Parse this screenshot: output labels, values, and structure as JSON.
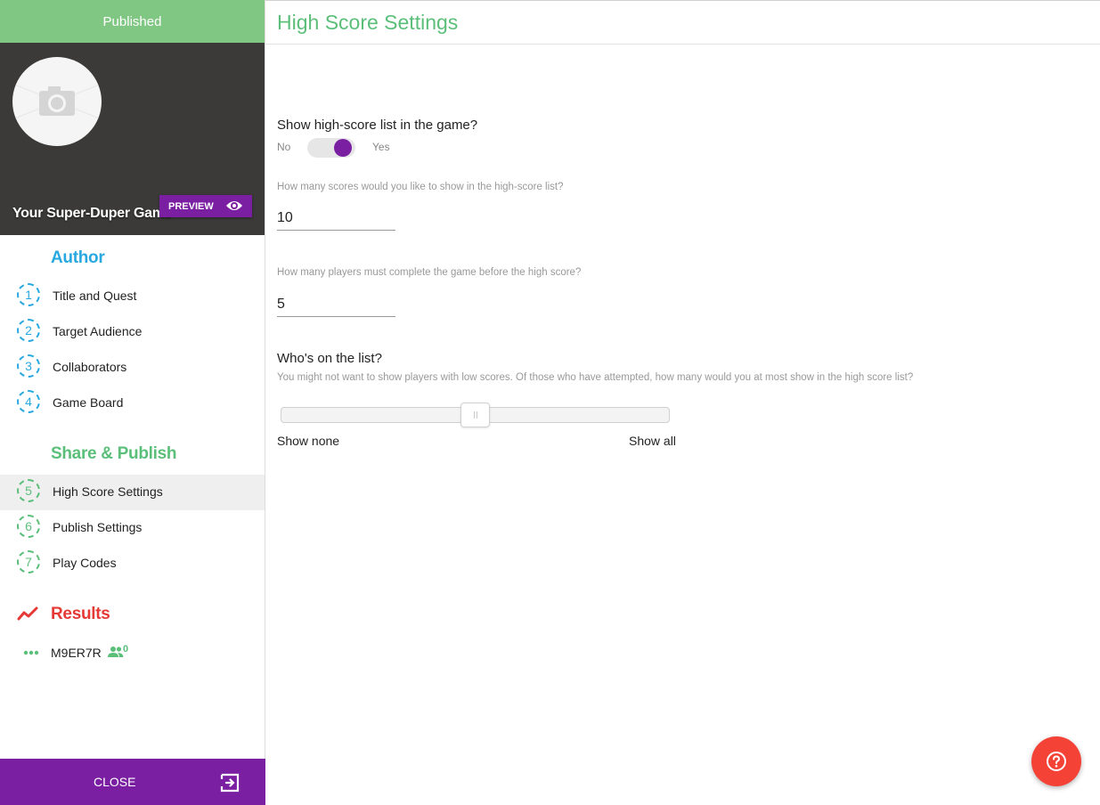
{
  "sidebar": {
    "status": "Published",
    "game_title": "Your Super-Duper Game",
    "preview_label": "PREVIEW",
    "author": {
      "title": "Author",
      "items": [
        {
          "number": "1",
          "label": "Title and Quest"
        },
        {
          "number": "2",
          "label": "Target Audience"
        },
        {
          "number": "3",
          "label": "Collaborators"
        },
        {
          "number": "4",
          "label": "Game Board"
        }
      ]
    },
    "share": {
      "title": "Share & Publish",
      "items": [
        {
          "number": "5",
          "label": "High Score Settings",
          "active": true
        },
        {
          "number": "6",
          "label": "Publish Settings"
        },
        {
          "number": "7",
          "label": "Play Codes"
        }
      ]
    },
    "results": {
      "title": "Results",
      "code": "M9ER7R",
      "player_count": "0"
    },
    "close_label": "CLOSE"
  },
  "main": {
    "title": "High Score Settings",
    "show_list": {
      "question": "Show high-score list in the game?",
      "off_label": "No",
      "on_label": "Yes",
      "value": true
    },
    "scores_count": {
      "label": "How many scores would you like to show in the high-score list?",
      "value": "10"
    },
    "min_players": {
      "label": "How many players must complete the game before the high score?",
      "value": "5"
    },
    "whos_on_list": {
      "heading": "Who's on the list?",
      "help": "You might not want to show players with low scores. Of those who have attempted, how many would you at most show in the high score list?",
      "min_label": "Show none",
      "max_label": "Show all",
      "value_fraction": 0.5
    }
  },
  "colors": {
    "accent_purple": "#7b1fa2",
    "published_green": "#81c784",
    "author_blue": "#29a8e0",
    "share_green": "#5bbf7a",
    "results_red": "#e53935",
    "help_red": "#f44336"
  },
  "icons": [
    "camera-icon",
    "eye-icon",
    "trend-icon",
    "dots-icon",
    "people-icon",
    "exit-icon",
    "help-icon"
  ]
}
